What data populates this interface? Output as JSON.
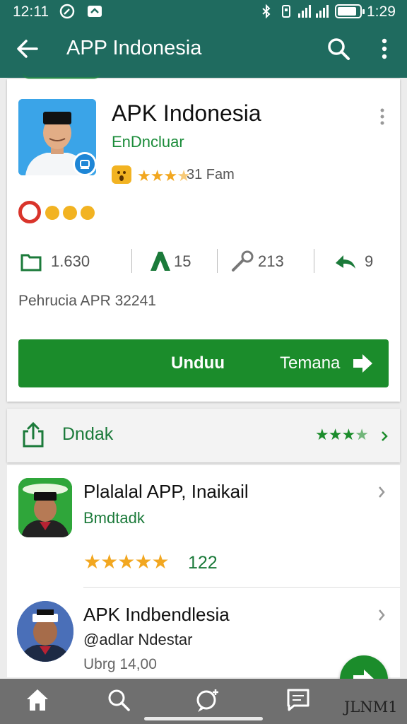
{
  "status_bar": {
    "time_left": "12:11",
    "time_right": "1:29",
    "battery_percent": 85
  },
  "app_bar": {
    "title": "APP Indonesia",
    "icons": [
      "back-arrow-icon",
      "search-icon",
      "more-vert-icon"
    ]
  },
  "app_card": {
    "name": "APK Indonesia",
    "developer": "EnDncluar",
    "rating_stars": 3.5,
    "rating_text": "31 Fam",
    "stats": [
      {
        "icon": "folder-icon",
        "value": "1.630"
      },
      {
        "icon": "person-icon",
        "value": "15"
      },
      {
        "icon": "share-icon",
        "value": "213"
      },
      {
        "icon": "reply-icon",
        "value": "9"
      }
    ],
    "meta": "Pehrucia APR 32241",
    "primary_button": "Unduu",
    "secondary_button": "Temana"
  },
  "section": {
    "label": "Dndak",
    "rating_stars": 3.5
  },
  "list": [
    {
      "title": "Plalalal APP, Inaikail",
      "subtitle": "Bmdtadk",
      "stars": 5,
      "count": "122"
    },
    {
      "title": "APK Indbendlesia",
      "subtitle": "@adlar Ndestar",
      "extra": "Ubrg 14,00"
    }
  ],
  "bottom_nav": {
    "items": [
      "home-icon",
      "search-icon",
      "chat-icon",
      "message-icon"
    ],
    "label": "JLNM1"
  },
  "colors": {
    "primary": "#1f6b5f",
    "accent_green": "#1b8c2b",
    "star": "#f2a720"
  }
}
